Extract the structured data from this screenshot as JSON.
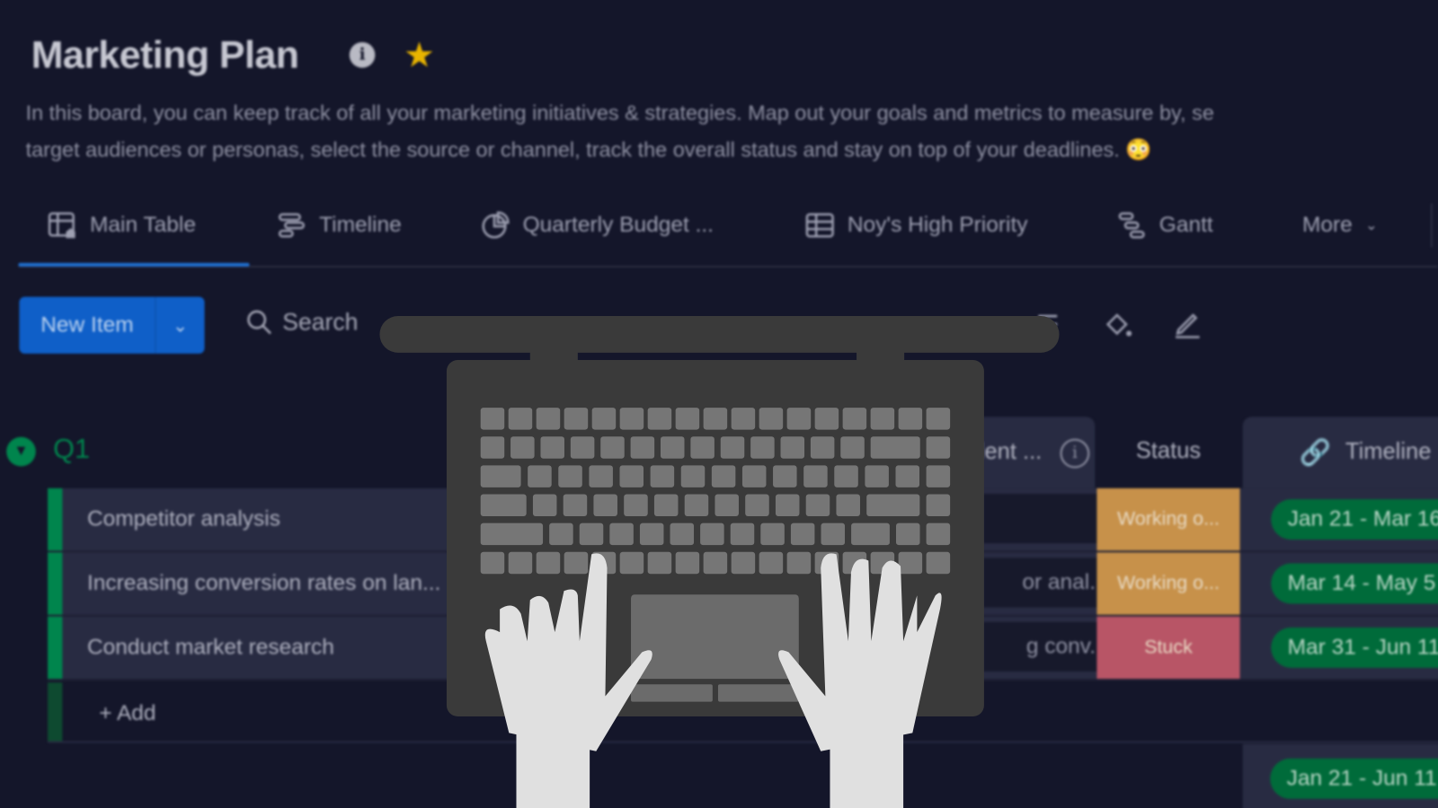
{
  "board": {
    "title": "Marketing Plan",
    "description_line1": "In this board, you can keep track of all your marketing initiatives & strategies. Map out your goals and metrics to measure by, se",
    "description_line2": "target audiences or personas, select the source or channel, track the overall status and stay on top of your deadlines. 😳",
    "favorite": true
  },
  "tabs": [
    {
      "label": "Main Table",
      "icon": "table-home-icon",
      "active": true
    },
    {
      "label": "Timeline",
      "icon": "timeline-icon"
    },
    {
      "label": "Quarterly Budget ...",
      "icon": "pie-chart-icon"
    },
    {
      "label": "Noy's High Priority",
      "icon": "table-icon"
    },
    {
      "label": "Gantt",
      "icon": "gantt-icon"
    },
    {
      "label": "More",
      "icon": "chevron-down-icon"
    }
  ],
  "toolbar": {
    "new_item": "New Item",
    "search": "Search"
  },
  "group": {
    "name": "Q1",
    "color": "#00854d",
    "columns": {
      "partial": "lent ...",
      "status": "Status",
      "timeline": "Timeline"
    },
    "rows": [
      {
        "name": "Competitor analysis",
        "partial": "",
        "status": "Working o...",
        "status_color": "#c7914a",
        "timeline": "Jan 21 - Mar 16"
      },
      {
        "name": "Increasing conversion rates on lan...",
        "partial": "or anal...",
        "status": "Working o...",
        "status_color": "#c7914a",
        "timeline": "Mar 14 - May 5"
      },
      {
        "name": "Conduct market research",
        "partial": "g conv...",
        "status": "Stuck",
        "status_color": "#b85566",
        "timeline": "Mar 31 - Jun 11"
      }
    ],
    "add_label": "+ Add",
    "summary_timeline": "Jan 21 - Jun 11"
  }
}
